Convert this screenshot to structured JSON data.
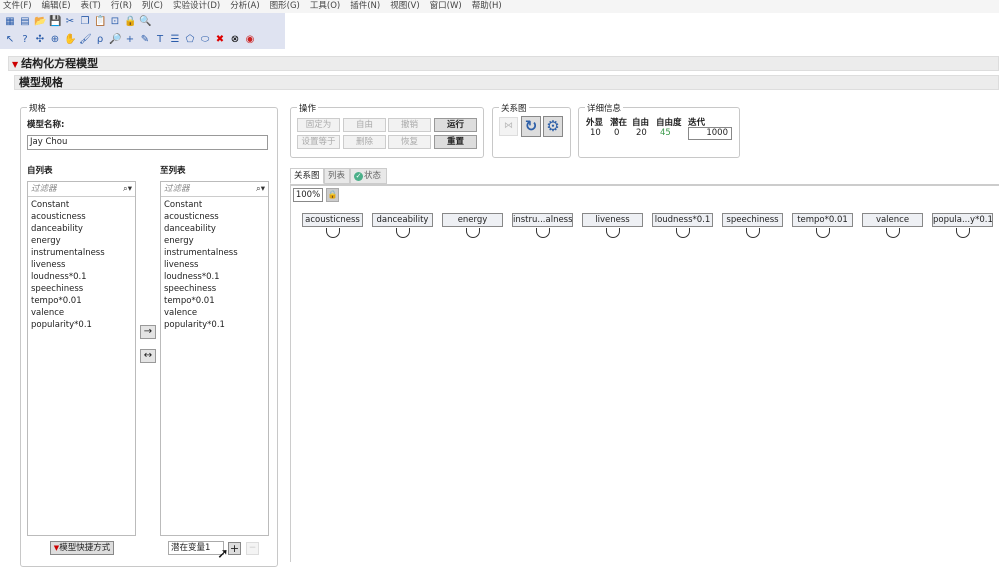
{
  "menu": [
    "文件(F)",
    "编辑(E)",
    "表(T)",
    "行(R)",
    "列(C)",
    "实验设计(D)",
    "分析(A)",
    "图形(G)",
    "工具(O)",
    "插件(N)",
    "视图(V)",
    "窗口(W)",
    "帮助(H)"
  ],
  "toolbar1": [
    "new-table-icon",
    "new-script-icon",
    "open-icon",
    "save-icon",
    "cut-icon",
    "copy-icon",
    "paste-icon",
    "tag-icon",
    "lock-icon",
    "search-icon"
  ],
  "toolbar2": [
    "arrow-icon",
    "help-icon",
    "grabber-icon",
    "crosshair-icon",
    "hand-icon",
    "brush-icon",
    "lasso-icon",
    "zoom-icon",
    "plus-icon",
    "pen-icon",
    "text-icon",
    "lines-icon",
    "polygon-icon",
    "ellipse-icon",
    "delete-icon",
    "close-circle-icon",
    "stop-icon"
  ],
  "title": "结构化方程模型",
  "subtitle": "模型规格",
  "spec": {
    "group": "规格",
    "name_label": "模型名称:",
    "name_value": "Jay Chou",
    "from_label": "自列表",
    "to_label": "至列表",
    "filter_placeholder": "过滤器",
    "from_items": [
      "Constant",
      "acousticness",
      "danceability",
      "energy",
      "instrumentalness",
      "liveness",
      "loudness*0.1",
      "speechiness",
      "tempo*0.01",
      "valence",
      "popularity*0.1"
    ],
    "to_items": [
      "Constant",
      "acousticness",
      "danceability",
      "energy",
      "instrumentalness",
      "liveness",
      "loudness*0.1",
      "speechiness",
      "tempo*0.01",
      "valence",
      "popularity*0.1"
    ],
    "shortcut": "模型快捷方式",
    "latent_value": "潜在变量1"
  },
  "ops": {
    "group": "操作",
    "buttons": [
      "固定为",
      "自由",
      "撤销",
      "运行",
      "设置等于",
      "删除",
      "恢复",
      "重置"
    ]
  },
  "diagram": {
    "group": "关系图"
  },
  "details": {
    "group": "详细信息",
    "headers": [
      "外显",
      "潜在",
      "自由",
      "自由度",
      "迭代"
    ],
    "values": [
      "10",
      "0",
      "20",
      "45"
    ],
    "iterations": "1000",
    "dof_color": "#3a9a4a"
  },
  "tabs": [
    "关系图",
    "列表",
    "状态"
  ],
  "zoom": "100%",
  "nodes": [
    "acousticness",
    "danceability",
    "energy",
    "instru...alness",
    "liveness",
    "loudness*0.1",
    "speechiness",
    "tempo*0.01",
    "valence",
    "popula...y*0.1"
  ]
}
